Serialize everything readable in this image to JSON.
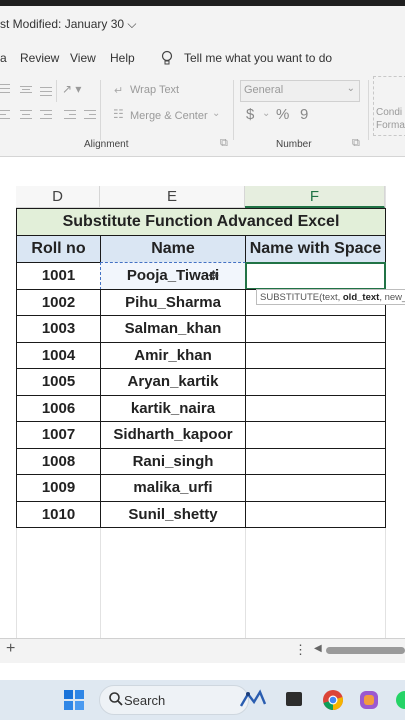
{
  "title_bar": {
    "title": "st Modified: January 30 ⌵"
  },
  "menu_tabs": [
    "a",
    "Review",
    "View",
    "Help"
  ],
  "tell_me": "Tell me what you want to do",
  "ribbon": {
    "wrap_text": "Wrap Text",
    "merge_center": "Merge & Center",
    "number_format": "General",
    "currency": "$",
    "percent": "%",
    "comma": "9",
    "alignment_label": "Alignment",
    "number_label": "Number",
    "conditional_line1": "Condi",
    "conditional_line2": "Forma"
  },
  "columns": [
    "D",
    "E",
    "F"
  ],
  "table": {
    "title": "Substitute Function Advanced Excel",
    "headers": [
      "Roll no",
      "Name",
      "Name with Space"
    ],
    "rows": [
      [
        "1001",
        "Pooja_Tiwari",
        ""
      ],
      [
        "1002",
        "Pihu_Sharma",
        ""
      ],
      [
        "1003",
        "Salman_khan",
        ""
      ],
      [
        "1004",
        "Amir_khan",
        ""
      ],
      [
        "1005",
        "Aryan_kartik",
        ""
      ],
      [
        "1006",
        "kartik_naira",
        ""
      ],
      [
        "1007",
        "Sidharth_kapoor",
        ""
      ],
      [
        "1008",
        "Rani_singh",
        ""
      ],
      [
        "1009",
        "malika_urfi",
        ""
      ],
      [
        "1010",
        "Sunil_shetty",
        ""
      ]
    ]
  },
  "tooltip": {
    "func": "SUBSTITUTE(",
    "arg1": "text, ",
    "arg2": "old_text",
    "arg3": ", new_t"
  },
  "sheet_bar": {
    "add": "+",
    "more": "⋮"
  },
  "taskbar": {
    "search": "Search"
  },
  "colors": {
    "title_fill": "#e2efd9",
    "header_fill": "#dae6f3",
    "selected_col": "#e6eedf",
    "selected_border": "#217346"
  }
}
